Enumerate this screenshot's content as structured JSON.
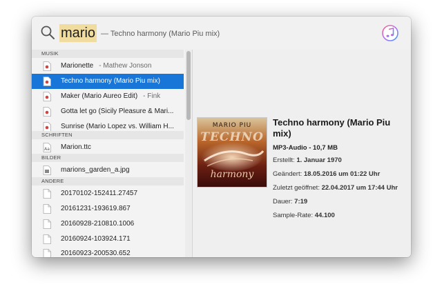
{
  "search": {
    "query": "mario",
    "completion_hint": "— Techno harmony (Mario Piu mix)",
    "itunes_icon": "itunes-music-note-icon",
    "search_icon": "magnifier-icon"
  },
  "sections": {
    "music": "MUSIK",
    "fonts": "SCHRIFTEN",
    "images": "BILDER",
    "other": "ANDERE"
  },
  "music_items": [
    {
      "title": "Marionette",
      "subtitle": "- Mathew Jonson"
    },
    {
      "title": "Techno harmony (Mario Piu mix)",
      "subtitle": ""
    },
    {
      "title": "Maker (Mario Aureo Edit)",
      "subtitle": "- Fink"
    },
    {
      "title": "Gotta let go (Sicily Pleasure & Mari...",
      "subtitle": ""
    },
    {
      "title": "Sunrise (Mario Lopez vs. William H...",
      "subtitle": ""
    }
  ],
  "font_items": [
    {
      "title": "Marion.ttc"
    }
  ],
  "image_items": [
    {
      "title": "marions_garden_a.jpg"
    }
  ],
  "other_items": [
    {
      "title": "20170102-152411.27457"
    },
    {
      "title": "20161231-193619.867"
    },
    {
      "title": "20160928-210810.1006"
    },
    {
      "title": "20160924-103924.171"
    },
    {
      "title": "20160923-200530.652"
    }
  ],
  "preview": {
    "title": "Techno harmony (Mario Piu mix)",
    "kind": "MP3-Audio - 10,7 MB",
    "created_label": "Erstellt:",
    "created_value": "1. Januar 1970",
    "modified_label": "Geändert:",
    "modified_value": "18.05.2016 um 01:22 Uhr",
    "opened_label": "Zuletzt geöffnet:",
    "opened_value": "22.04.2017 um 17:44 Uhr",
    "duration_label": "Dauer:",
    "duration_value": "7:19",
    "samplerate_label": "Sample-Rate:",
    "samplerate_value": "44.100",
    "cover": {
      "artist_text": "MARIO PIU",
      "title_text": "TECHNO",
      "bottom_text": "harmony"
    }
  },
  "colors": {
    "selection": "#1776d8",
    "query_highlight": "#f0dc9e"
  }
}
